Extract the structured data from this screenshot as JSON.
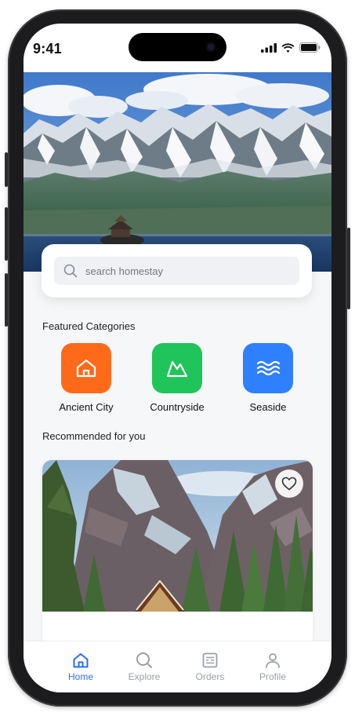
{
  "status_bar": {
    "time": "9:41"
  },
  "search": {
    "placeholder": "search homestay"
  },
  "featured": {
    "title": "Featured Categories",
    "items": [
      {
        "label": "Ancient City",
        "color": "#ff6a1a",
        "icon": "house-icon"
      },
      {
        "label": "Countryside",
        "color": "#1fc45a",
        "icon": "mountain-icon"
      },
      {
        "label": "Seaside",
        "color": "#2f80ff",
        "icon": "waves-icon"
      }
    ]
  },
  "recommended": {
    "title": "Recommended for you"
  },
  "tabbar": {
    "items": [
      {
        "label": "Home",
        "icon": "home-icon",
        "active": true
      },
      {
        "label": "Explore",
        "icon": "search-icon",
        "active": false
      },
      {
        "label": "Orders",
        "icon": "orders-icon",
        "active": false
      },
      {
        "label": "Profile",
        "icon": "profile-icon",
        "active": false
      }
    ]
  },
  "colors": {
    "accent": "#2b6ef0",
    "inactive": "#9aa0a6"
  }
}
